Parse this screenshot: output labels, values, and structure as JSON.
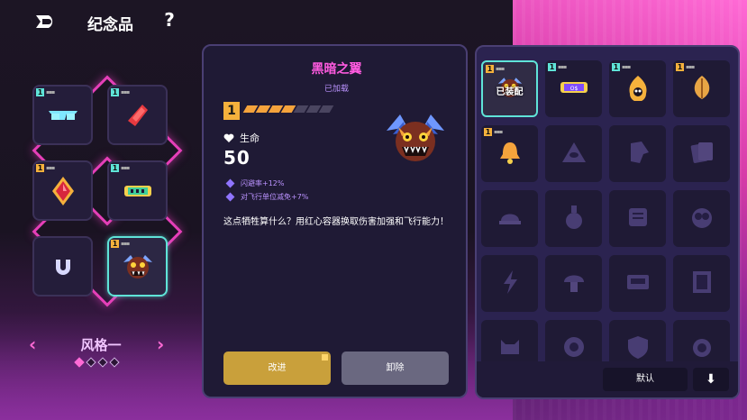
{
  "header": {
    "title": "纪念品",
    "help_label": "?"
  },
  "left": {
    "style_label": "风格一",
    "arrow_left": "‹",
    "arrow_right": "›",
    "style_pages": 4,
    "style_active_index": 0
  },
  "detail": {
    "name": "黑暗之翼",
    "status": "已加载",
    "level": "1",
    "level_pips_filled": 4,
    "level_pips_total": 7,
    "stat_label": "生命",
    "stat_value": "50",
    "bonuses": [
      "闪避率+12%",
      "对飞行单位减免+7%"
    ],
    "description": "这点牺牲算什么？用红心容器换取伤害加强和飞行能力！",
    "upgrade_label": "改进",
    "unequip_label": "卸除"
  },
  "list": {
    "equipped_label": "已装配",
    "default_label": "默认",
    "sort_label": "⬇"
  },
  "colors": {
    "accent_pink": "#ff5be0",
    "accent_cyan": "#5fe4d8",
    "level_gold": "#f5b13c",
    "panel": "#1f1a35"
  },
  "slots": [
    {
      "icon": "sunglasses-icon",
      "level": "1"
    },
    {
      "icon": "sausage-icon",
      "level": "1"
    },
    {
      "icon": "red-gem-icon",
      "level": "1"
    },
    {
      "icon": "scroll-icon",
      "level": "1"
    },
    {
      "icon": "horseshoe-icon",
      "level": ""
    },
    {
      "icon": "dark-wing-demon-icon",
      "level": "1"
    }
  ],
  "grid": [
    {
      "icon": "dark-wing-demon-icon",
      "level": "1",
      "equipped": true
    },
    {
      "icon": "ticket-icon",
      "level": "1"
    },
    {
      "icon": "fire-pot-icon",
      "level": "1"
    },
    {
      "icon": "leaf-icon",
      "level": "1"
    },
    {
      "icon": "bell-icon",
      "level": "1"
    },
    {
      "icon": "eye-pyramid-icon"
    },
    {
      "icon": "horse-head-icon"
    },
    {
      "icon": "cards-icon"
    },
    {
      "icon": "cap-icon"
    },
    {
      "icon": "potion-icon"
    },
    {
      "icon": "scroll-paper-icon"
    },
    {
      "icon": "owl-icon"
    },
    {
      "icon": "lightning-icon"
    },
    {
      "icon": "mushroom-icon"
    },
    {
      "icon": "radio-icon"
    },
    {
      "icon": "painting-icon"
    },
    {
      "icon": "cat-icon"
    },
    {
      "icon": "medal-icon"
    },
    {
      "icon": "shield-icon"
    },
    {
      "icon": "lens-icon"
    }
  ]
}
